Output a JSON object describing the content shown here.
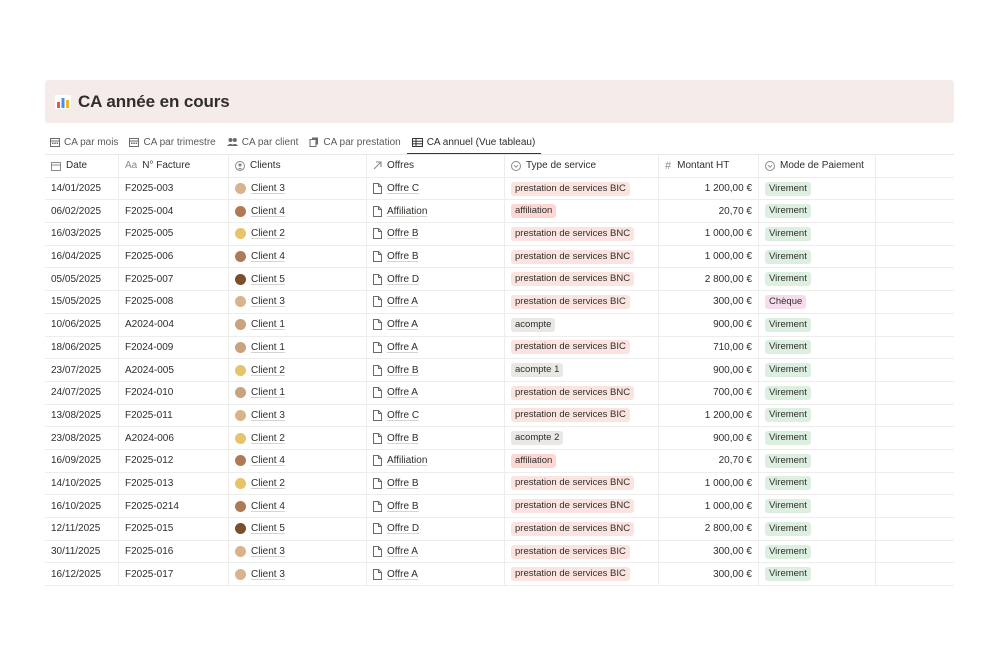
{
  "header": {
    "title": "CA année en cours",
    "icon": "bar-chart-icon"
  },
  "tabs": [
    {
      "label": "CA par mois",
      "icon": "calendar-icon"
    },
    {
      "label": "CA par trimestre",
      "icon": "calendar-icon"
    },
    {
      "label": "CA par client",
      "icon": "people-icon"
    },
    {
      "label": "CA par prestation",
      "icon": "stack-icon"
    },
    {
      "label": "CA annuel (Vue tableau)",
      "icon": "table-icon",
      "active": true
    }
  ],
  "columns": {
    "date": "Date",
    "facture": "N° Facture",
    "clients": "Clients",
    "offres": "Offres",
    "type": "Type de service",
    "montant": "Montant HT",
    "mode": "Mode de Paiement"
  },
  "colors": {
    "bic": "#fbe4e0",
    "bnc": "#fbe4e0",
    "affiliation": "#fcd7d3",
    "acompte": "#e9e8e5",
    "virement": "#dcefe0",
    "cheque": "#f7dcec"
  },
  "rows": [
    {
      "date": "14/01/2025",
      "facture": "F2025-003",
      "client": "Client 3",
      "offre": "Offre C",
      "type": "prestation de services BIC",
      "type_key": "bic",
      "montant": "1 200,00 €",
      "mode": "Virement",
      "mode_key": "virement"
    },
    {
      "date": "06/02/2025",
      "facture": "F2025-004",
      "client": "Client 4",
      "offre": "Affiliation",
      "type": "affiliation",
      "type_key": "affiliation",
      "montant": "20,70 €",
      "mode": "Virement",
      "mode_key": "virement"
    },
    {
      "date": "16/03/2025",
      "facture": "F2025-005",
      "client": "Client 2",
      "offre": "Offre B",
      "type": "prestation de services BNC",
      "type_key": "bnc",
      "montant": "1 000,00 €",
      "mode": "Virement",
      "mode_key": "virement"
    },
    {
      "date": "16/04/2025",
      "facture": "F2025-006",
      "client": "Client 4",
      "offre": "Offre B",
      "type": "prestation de services BNC",
      "type_key": "bnc",
      "montant": "1 000,00 €",
      "mode": "Virement",
      "mode_key": "virement"
    },
    {
      "date": "05/05/2025",
      "facture": "F2025-007",
      "client": "Client 5",
      "offre": "Offre D",
      "type": "prestation de services BNC",
      "type_key": "bnc",
      "montant": "2 800,00 €",
      "mode": "Virement",
      "mode_key": "virement"
    },
    {
      "date": "15/05/2025",
      "facture": "F2025-008",
      "client": "Client 3",
      "offre": "Offre A",
      "type": "prestation de services BIC",
      "type_key": "bic",
      "montant": "300,00 €",
      "mode": "Chèque",
      "mode_key": "cheque"
    },
    {
      "date": "10/06/2025",
      "facture": "A2024-004",
      "client": "Client 1",
      "offre": "Offre A",
      "type": "acompte",
      "type_key": "acompte",
      "montant": "900,00 €",
      "mode": "Virement",
      "mode_key": "virement"
    },
    {
      "date": "18/06/2025",
      "facture": "F2024-009",
      "client": "Client 1",
      "offre": "Offre A",
      "type": "prestation de services BIC",
      "type_key": "bic",
      "montant": "710,00 €",
      "mode": "Virement",
      "mode_key": "virement"
    },
    {
      "date": "23/07/2025",
      "facture": "A2024-005",
      "client": "Client 2",
      "offre": "Offre B",
      "type": "acompte 1",
      "type_key": "acompte",
      "montant": "900,00 €",
      "mode": "Virement",
      "mode_key": "virement"
    },
    {
      "date": "24/07/2025",
      "facture": "F2024-010",
      "client": "Client 1",
      "offre": "Offre A",
      "type": "prestation de services BNC",
      "type_key": "bnc",
      "montant": "700,00 €",
      "mode": "Virement",
      "mode_key": "virement"
    },
    {
      "date": "13/08/2025",
      "facture": "F2025-011",
      "client": "Client 3",
      "offre": "Offre C",
      "type": "prestation de services BIC",
      "type_key": "bic",
      "montant": "1 200,00 €",
      "mode": "Virement",
      "mode_key": "virement"
    },
    {
      "date": "23/08/2025",
      "facture": "A2024-006",
      "client": "Client 2",
      "offre": "Offre B",
      "type": "acompte 2",
      "type_key": "acompte",
      "montant": "900,00 €",
      "mode": "Virement",
      "mode_key": "virement"
    },
    {
      "date": "16/09/2025",
      "facture": "F2025-012",
      "client": "Client 4",
      "offre": "Affiliation",
      "type": "affiliation",
      "type_key": "affiliation",
      "montant": "20,70 €",
      "mode": "Virement",
      "mode_key": "virement"
    },
    {
      "date": "14/10/2025",
      "facture": "F2025-013",
      "client": "Client 2",
      "offre": "Offre B",
      "type": "prestation de services BNC",
      "type_key": "bnc",
      "montant": "1 000,00 €",
      "mode": "Virement",
      "mode_key": "virement"
    },
    {
      "date": "16/10/2025",
      "facture": "F2025-0214",
      "client": "Client 4",
      "offre": "Offre B",
      "type": "prestation de services BNC",
      "type_key": "bnc",
      "montant": "1 000,00 €",
      "mode": "Virement",
      "mode_key": "virement"
    },
    {
      "date": "12/11/2025",
      "facture": "F2025-015",
      "client": "Client 5",
      "offre": "Offre D",
      "type": "prestation de services BNC",
      "type_key": "bnc",
      "montant": "2 800,00 €",
      "mode": "Virement",
      "mode_key": "virement"
    },
    {
      "date": "30/11/2025",
      "facture": "F2025-016",
      "client": "Client 3",
      "offre": "Offre A",
      "type": "prestation de services BIC",
      "type_key": "bic",
      "montant": "300,00 €",
      "mode": "Virement",
      "mode_key": "virement"
    },
    {
      "date": "16/12/2025",
      "facture": "F2025-017",
      "client": "Client 3",
      "offre": "Offre A",
      "type": "prestation de services BIC",
      "type_key": "bic",
      "montant": "300,00 €",
      "mode": "Virement",
      "mode_key": "virement"
    }
  ]
}
